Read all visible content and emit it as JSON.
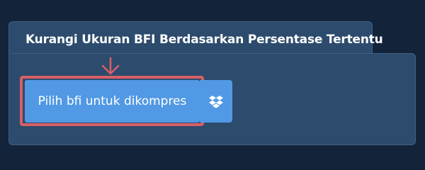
{
  "panel": {
    "title": "Kurangi Ukuran BFI Berdasarkan Persentase Tertentu",
    "upload_button_label": "Pilih bfi untuk dikompres",
    "dropbox_icon": "dropbox-icon",
    "arrow_icon": "arrow-down-icon"
  },
  "colors": {
    "background": "#13233a",
    "panel": "#2d4b6d",
    "button": "#5199e4",
    "highlight": "#d95f67"
  }
}
